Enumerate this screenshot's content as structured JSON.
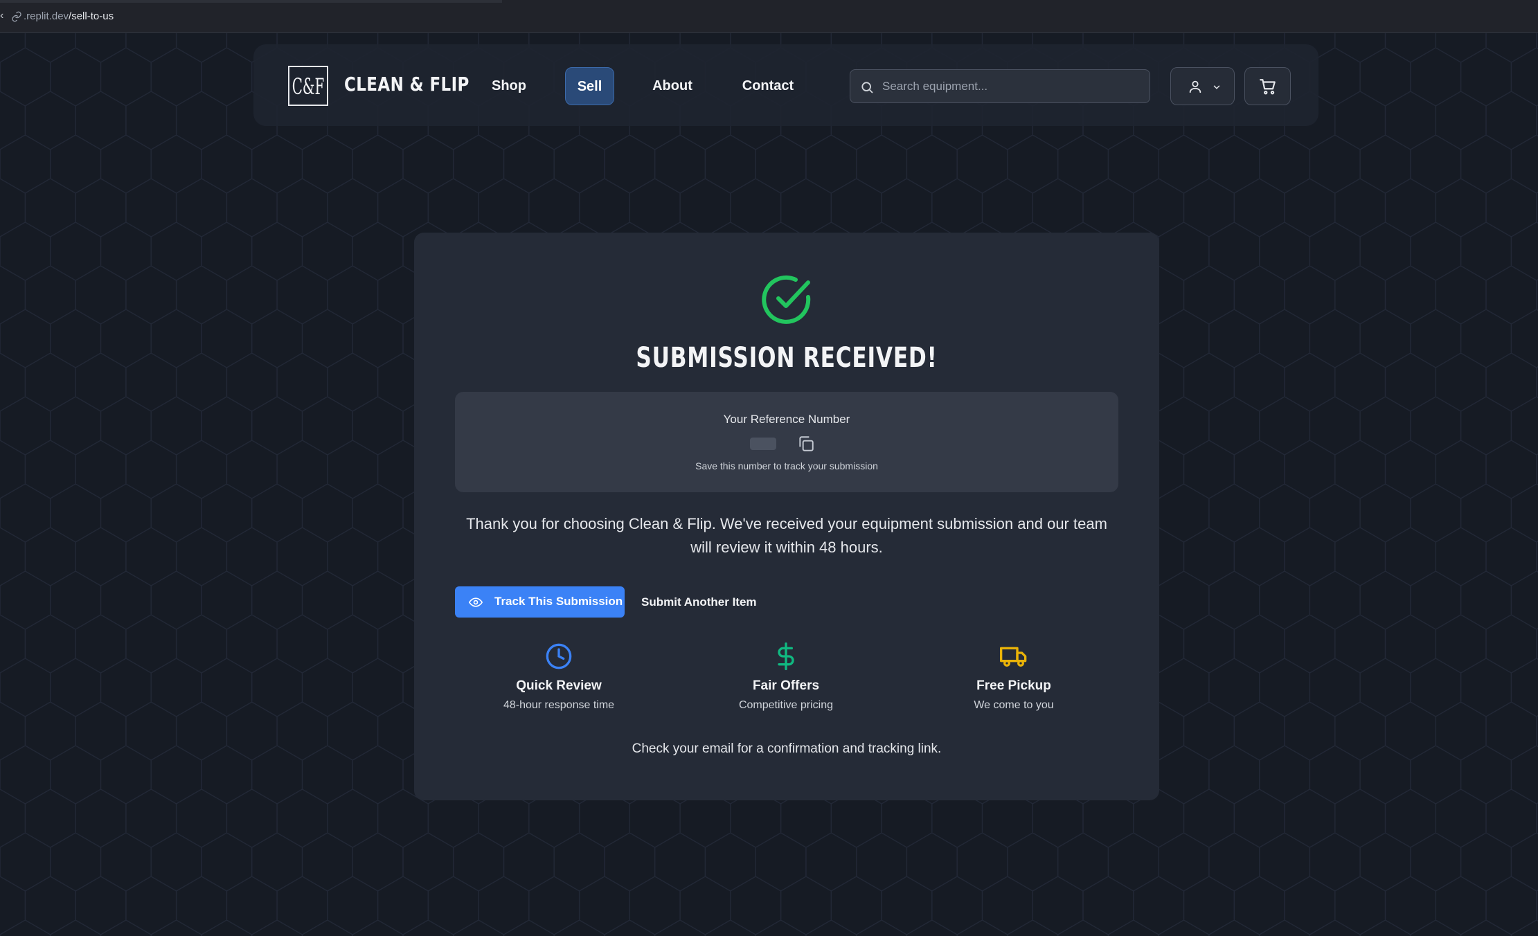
{
  "browser": {
    "url_host": ".replit.dev",
    "url_path": "/sell-to-us"
  },
  "header": {
    "logo_text": "C&F",
    "brand": "CLEAN & FLIP",
    "nav": [
      {
        "label": "Shop",
        "active": false
      },
      {
        "label": "Sell",
        "active": true
      },
      {
        "label": "About",
        "active": false
      },
      {
        "label": "Contact",
        "active": false
      }
    ],
    "search": {
      "placeholder": "Search equipment...",
      "value": ""
    },
    "account_icon": "user-icon",
    "cart_icon": "shopping-cart-icon"
  },
  "confirmation": {
    "status_icon": "check-circle-icon",
    "title": "SUBMISSION RECEIVED!",
    "reference": {
      "label": "Your Reference Number",
      "value": "",
      "copy_icon": "copy-icon",
      "hint": "Save this number to track your submission"
    },
    "message": "Thank you for choosing Clean & Flip. We've received your equipment submission and our team will review it within 48 hours.",
    "primary_button": {
      "label": "Track This Submission",
      "icon": "eye-icon"
    },
    "secondary_button": {
      "label": "Submit Another Item"
    },
    "features": [
      {
        "icon": "clock-icon",
        "title": "Quick Review",
        "subtitle": "48-hour response time",
        "color": "#3b82f6"
      },
      {
        "icon": "dollar-icon",
        "title": "Fair Offers",
        "subtitle": "Competitive pricing",
        "color": "#10b981"
      },
      {
        "icon": "truck-icon",
        "title": "Free Pickup",
        "subtitle": "We come to you",
        "color": "#eab308"
      }
    ],
    "footer_note": "Check your email for a confirmation and tracking link."
  },
  "colors": {
    "background": "#161b24",
    "card": "#252b37",
    "accent": "#3b82f6",
    "success": "#22c55e",
    "active_nav": "#2a4a78"
  }
}
